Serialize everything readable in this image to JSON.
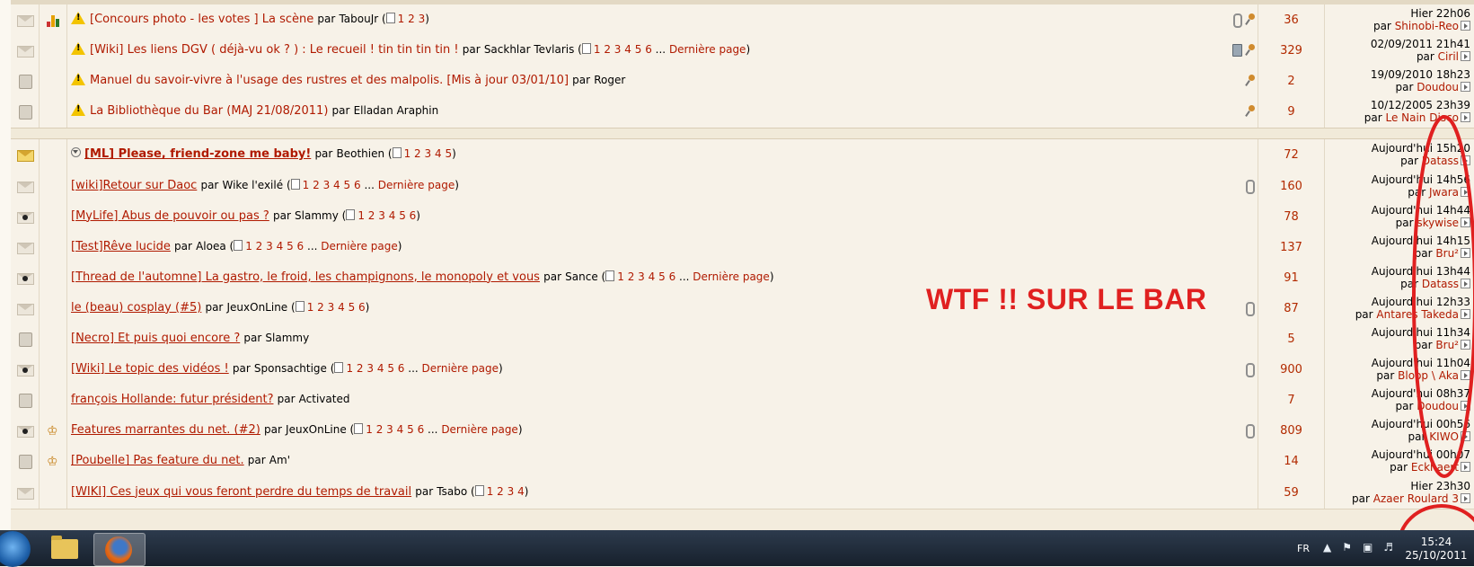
{
  "annotation": {
    "text": "WTF !! SUR LE BAR",
    "color": "#e02020"
  },
  "colors": {
    "link": "#b01a00",
    "replies": "#b22a00",
    "row_bg": "#f7f2e8"
  },
  "pinned_topics": [
    {
      "icon": "poll-icon",
      "warn": true,
      "title": "[Concours photo - les votes ] La scène",
      "par_label": "par",
      "author": "TabouJr",
      "pages": [
        "1",
        "2",
        "3"
      ],
      "derniere": "",
      "flags": [
        "paperclip-icon",
        "pin-icon"
      ],
      "replies": "36",
      "last_date": "Hier 22h06",
      "last_by_label": "par",
      "last_user": "Shinobi-Reo"
    },
    {
      "icon": "envelope-icon",
      "warn": true,
      "title": "[Wiki] Les liens DGV ( déjà-vu ok ? ) : Le recueil ! tin tin tin tin !",
      "par_label": "par",
      "author": "Sackhlar Tevlaris",
      "pages": [
        "1",
        "2",
        "3",
        "4",
        "5",
        "6"
      ],
      "derniere": "Dernière page",
      "flags": [
        "trash-icon",
        "pin-icon"
      ],
      "replies": "329",
      "last_date": "02/09/2011 21h41",
      "last_by_label": "par",
      "last_user": "Ciril"
    },
    {
      "icon": "lock-icon",
      "warn": true,
      "title": "Manuel du savoir-vivre à l'usage des rustres et des malpolis. [Mis à jour 03/01/10]",
      "par_label": "par",
      "author": "Roger",
      "pages": [],
      "derniere": "",
      "flags": [
        "pin-icon"
      ],
      "replies": "2",
      "last_date": "19/09/2010 18h23",
      "last_by_label": "par",
      "last_user": "Doudou"
    },
    {
      "icon": "lock-icon",
      "warn": true,
      "title": "La Bibliothèque du Bar (MAJ 21/08/2011)",
      "par_label": "par",
      "author": "Elladan Araphin",
      "pages": [],
      "derniere": "",
      "flags": [
        "pin-icon"
      ],
      "replies": "9",
      "last_date": "10/12/2005 23h39",
      "last_by_label": "par",
      "last_user": "Le Nain Disco"
    }
  ],
  "topics": [
    {
      "icon": "envelope-yellow-icon",
      "bold": true,
      "toggle": true,
      "title": "[ML] Please, friend-zone me baby!",
      "par_label": "par",
      "author": "Beothien",
      "pages": [
        "1",
        "2",
        "3",
        "4",
        "5"
      ],
      "derniere": "",
      "flags": [],
      "replies": "72",
      "last_date": "Aujourd'hui 15h20",
      "last_by_label": "par",
      "last_user": "Datass"
    },
    {
      "icon": "envelope-icon",
      "title": "[wiki]Retour sur Daoc",
      "par_label": "par",
      "author": "Wike l'exilé",
      "pages": [
        "1",
        "2",
        "3",
        "4",
        "5",
        "6"
      ],
      "derniere": "Dernière page",
      "flags": [
        "paperclip-icon"
      ],
      "replies": "160",
      "last_date": "Aujourd'hui 14h56",
      "last_by_label": "par",
      "last_user": "Jwara"
    },
    {
      "icon": "envelope-dot-icon",
      "title": "[MyLife] Abus de pouvoir ou pas ?",
      "par_label": "par",
      "author": "Slammy",
      "pages": [
        "1",
        "2",
        "3",
        "4",
        "5",
        "6"
      ],
      "derniere": "",
      "flags": [],
      "replies": "78",
      "last_date": "Aujourd'hui 14h44",
      "last_by_label": "par",
      "last_user": "skywise"
    },
    {
      "icon": "envelope-icon",
      "title": "[Test]Rêve lucide",
      "par_label": "par",
      "author": "Aloea",
      "pages": [
        "1",
        "2",
        "3",
        "4",
        "5",
        "6"
      ],
      "derniere": "Dernière page",
      "flags": [],
      "replies": "137",
      "last_date": "Aujourd'hui 14h15",
      "last_by_label": "par",
      "last_user": "Bru²"
    },
    {
      "icon": "envelope-dot-icon",
      "title": "[Thread de l'automne] La gastro, le froid, les champignons, le monopoly et vous",
      "par_label": "par",
      "author": "Sance",
      "pages": [
        "1",
        "2",
        "3",
        "4",
        "5",
        "6"
      ],
      "derniere": "Dernière page",
      "flags": [],
      "replies": "91",
      "last_date": "Aujourd'hui 13h44",
      "last_by_label": "par",
      "last_user": "Datass"
    },
    {
      "icon": "envelope-icon",
      "title": "le (beau) cosplay (#5)",
      "par_label": "par",
      "author": "JeuxOnLine",
      "pages": [
        "1",
        "2",
        "3",
        "4",
        "5",
        "6"
      ],
      "derniere": "",
      "flags": [
        "paperclip-icon"
      ],
      "replies": "87",
      "last_date": "Aujourd'hui 12h33",
      "last_by_label": "par",
      "last_user": "Antares Takeda"
    },
    {
      "icon": "lock-icon",
      "title": "[Necro] Et puis quoi encore ?",
      "par_label": "par",
      "author": "Slammy",
      "pages": [],
      "derniere": "",
      "flags": [],
      "replies": "5",
      "last_date": "Aujourd'hui 11h34",
      "last_by_label": "par",
      "last_user": "Bru²"
    },
    {
      "icon": "envelope-dot-icon",
      "title": "[Wiki] Le topic des vidéos !",
      "par_label": "par",
      "author": "Sponsachtige",
      "pages": [
        "1",
        "2",
        "3",
        "4",
        "5",
        "6"
      ],
      "derniere": "Dernière page",
      "flags": [
        "paperclip-icon"
      ],
      "replies": "900",
      "last_date": "Aujourd'hui 11h04",
      "last_by_label": "par",
      "last_user": "Bloop \\ Aka"
    },
    {
      "icon": "lock-icon",
      "title": "françois Hollande: futur président?",
      "par_label": "par",
      "author": "Activated",
      "pages": [],
      "derniere": "",
      "flags": [],
      "replies": "7",
      "last_date": "Aujourd'hui 08h37",
      "last_by_label": "par",
      "last_user": "Doudou"
    },
    {
      "icon": "envelope-dot-icon",
      "icon2": "bell-icon",
      "title": "Features marrantes du net. (#2)",
      "par_label": "par",
      "author": "JeuxOnLine",
      "pages": [
        "1",
        "2",
        "3",
        "4",
        "5",
        "6"
      ],
      "derniere": "Dernière page",
      "flags": [
        "paperclip-icon"
      ],
      "replies": "809",
      "last_date": "Aujourd'hui 00h56",
      "last_by_label": "par",
      "last_user": "KIWO"
    },
    {
      "icon": "lock-icon",
      "icon2": "bell-icon",
      "title": "[Poubelle] Pas feature du net.",
      "par_label": "par",
      "author": "Am'",
      "pages": [],
      "derniere": "",
      "flags": [],
      "replies": "14",
      "last_date": "Aujourd'hui 00h07",
      "last_by_label": "par",
      "last_user": "Eckhaert"
    },
    {
      "icon": "envelope-icon",
      "title": "[WIKI] Ces jeux qui vous feront perdre du temps de travail",
      "par_label": "par",
      "author": "Tsabo",
      "pages": [
        "1",
        "2",
        "3",
        "4"
      ],
      "derniere": "",
      "flags": [],
      "replies": "59",
      "last_date": "Hier 23h30",
      "last_by_label": "par",
      "last_user": "Azaer Roulard 3"
    }
  ],
  "taskbar": {
    "lang": "FR",
    "time": "15:24",
    "date": "25/10/2011",
    "apps": [
      "explorer-icon",
      "firefox-icon"
    ]
  }
}
